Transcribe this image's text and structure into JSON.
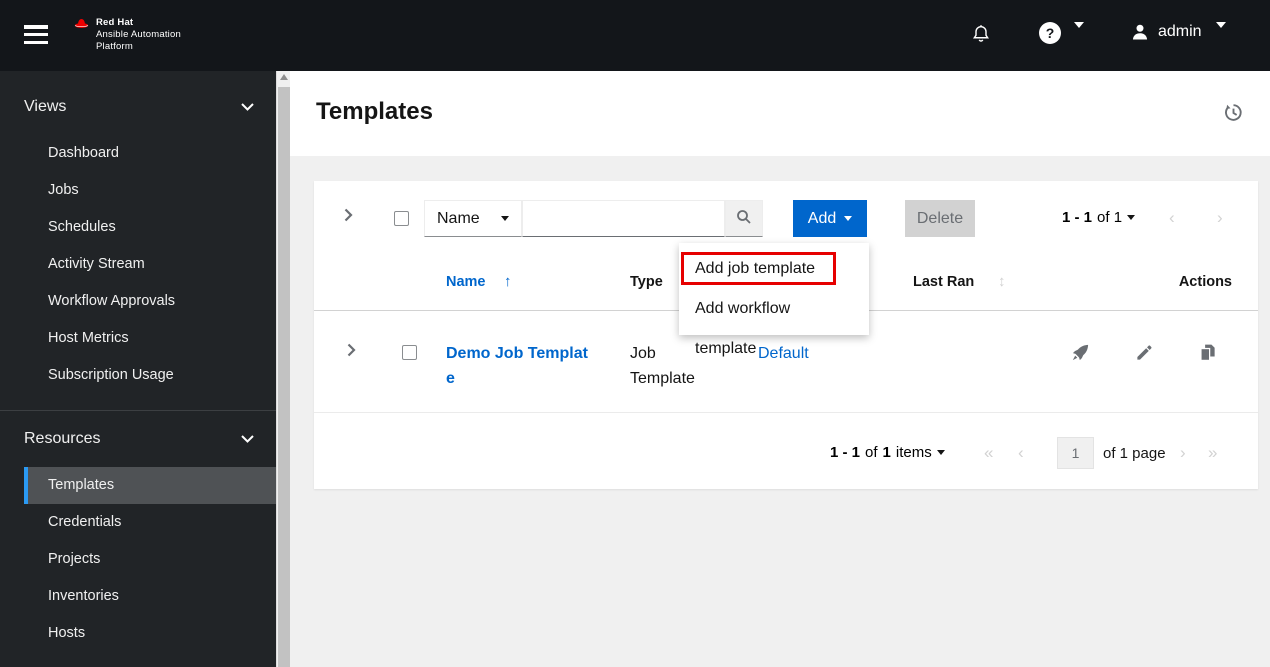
{
  "masthead": {
    "brand_line1": "Red Hat",
    "brand_line2": "Ansible Automation",
    "brand_line3": "Platform",
    "username": "admin"
  },
  "sidebar": {
    "sections": [
      {
        "label": "Views",
        "items": [
          {
            "label": "Dashboard"
          },
          {
            "label": "Jobs"
          },
          {
            "label": "Schedules"
          },
          {
            "label": "Activity Stream"
          },
          {
            "label": "Workflow Approvals"
          },
          {
            "label": "Host Metrics"
          },
          {
            "label": "Subscription Usage"
          }
        ]
      },
      {
        "label": "Resources",
        "items": [
          {
            "label": "Templates",
            "selected": true
          },
          {
            "label": "Credentials"
          },
          {
            "label": "Projects"
          },
          {
            "label": "Inventories"
          },
          {
            "label": "Hosts"
          }
        ]
      }
    ]
  },
  "page": {
    "title": "Templates"
  },
  "toolbar": {
    "filter_label": "Name",
    "search_value": "",
    "add_label": "Add",
    "delete_label": "Delete",
    "pagination_range": "1 - 1",
    "pagination_of": "of 1"
  },
  "add_menu": {
    "items": [
      "Add job template",
      "Add workflow template"
    ]
  },
  "table": {
    "headers": {
      "name": "Name",
      "type": "Type",
      "last_ran": "Last Ran",
      "actions": "Actions"
    },
    "row": {
      "name": "Demo Job Template",
      "type": "Job Template",
      "organization": "Default"
    }
  },
  "footer_pagination": {
    "range": "1 - 1",
    "of_word": "of",
    "total": "1",
    "items_word": "items",
    "page_value": "1",
    "page_label": "of 1 page"
  },
  "icons": {
    "sort_asc": "↑",
    "sort_both": "↕",
    "first": "«",
    "prev": "‹",
    "next": "›",
    "last": "»"
  },
  "colors": {
    "accent": "#0066cc",
    "annotation_red": "#e60000",
    "nav_selected_bg": "#4f5255",
    "nav_accent_bar": "#2b9af3",
    "masthead_bg": "#13161a",
    "sidebar_bg": "#212427"
  }
}
